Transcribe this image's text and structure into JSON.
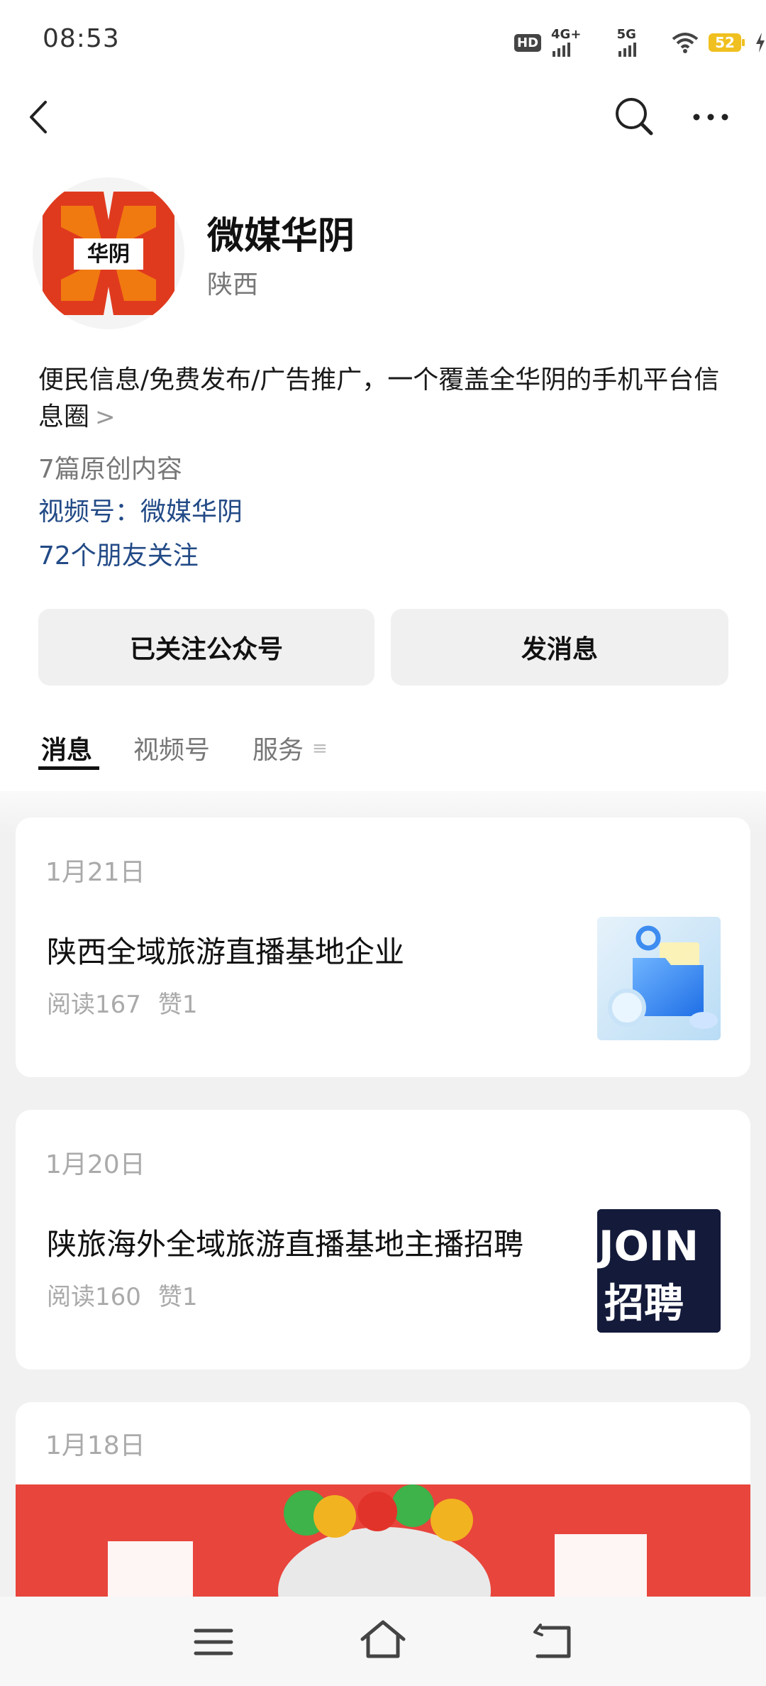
{
  "status": {
    "time": "08:53",
    "hd": "HD",
    "net1": "4G+",
    "net2": "5G",
    "battery": "52"
  },
  "profile": {
    "avatar_text": "华阴",
    "name": "微媒华阴",
    "region": "陕西",
    "description": "便民信息/免费发布/广告推广，一个覆盖全华阴的手机平台信息圈",
    "original_count": "7篇原创内容",
    "channel_label": "视频号：",
    "channel_name": "微媒华阴",
    "friends_following": "72个朋友关注"
  },
  "buttons": {
    "follow": "已关注公众号",
    "message": "发消息"
  },
  "tabs": [
    {
      "label": "消息",
      "active": true
    },
    {
      "label": "视频号",
      "active": false
    },
    {
      "label": "服务",
      "active": false
    }
  ],
  "posts": [
    {
      "date": "1月21日",
      "title": "陕西全域旅游直播基地企业",
      "reads": "阅读167",
      "likes": "赞1"
    },
    {
      "date": "1月20日",
      "title": "陕旅海外全域旅游直播基地主播招聘",
      "reads": "阅读160",
      "likes": "赞1",
      "thumb_top": "JOIN",
      "thumb_bottom": "招聘"
    },
    {
      "date": "1月18日"
    }
  ],
  "colors": {
    "link": "#224a86",
    "avatar_red": "#e03a1e",
    "avatar_orange": "#f07a10",
    "banner_red": "#e8453c"
  },
  "icons": [
    "back-icon",
    "search-icon",
    "more-icon",
    "chevron-right-icon",
    "menu-icon",
    "home-icon",
    "return-icon"
  ]
}
